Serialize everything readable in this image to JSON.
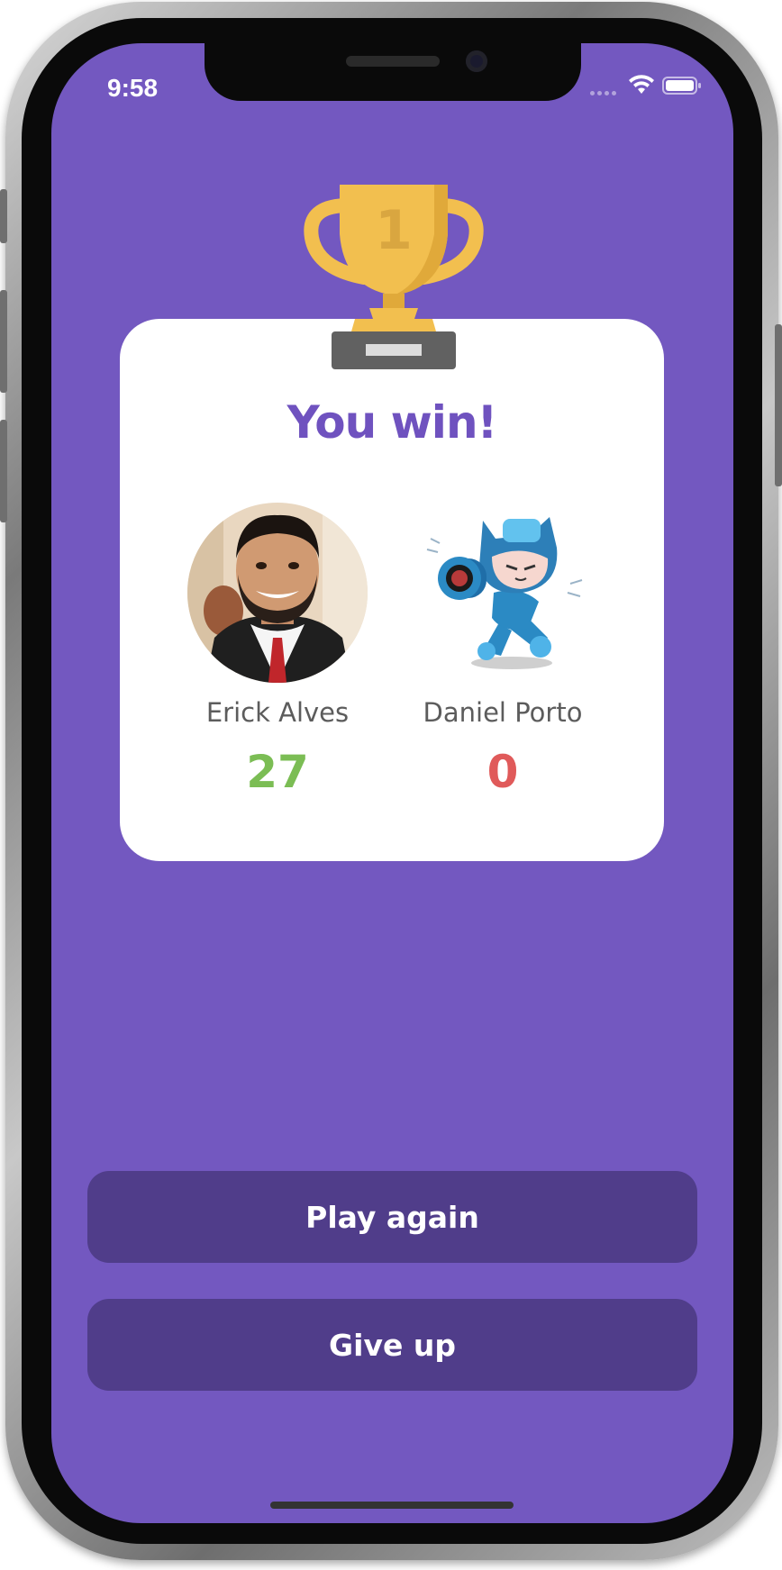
{
  "status_bar": {
    "time": "9:58",
    "icons": [
      "signal-dots-icon",
      "wifi-icon",
      "battery-icon"
    ]
  },
  "trophy": {
    "icon": "trophy-icon",
    "rank": "1"
  },
  "result": {
    "title": "You win!"
  },
  "players": [
    {
      "name": "Erick Alves",
      "score": "27",
      "avatar": "user-photo-avatar"
    },
    {
      "name": "Daniel Porto",
      "score": "0",
      "avatar": "octocat-megaman-avatar"
    }
  ],
  "actions": {
    "play_again": "Play again",
    "give_up": "Give up"
  },
  "colors": {
    "background": "#7358c0",
    "card": "#ffffff",
    "title": "#6f52bf",
    "button": "#503d8a",
    "score_win": "#7bbd54",
    "score_lose": "#e05a5a",
    "trophy": "#f2bf4f"
  }
}
